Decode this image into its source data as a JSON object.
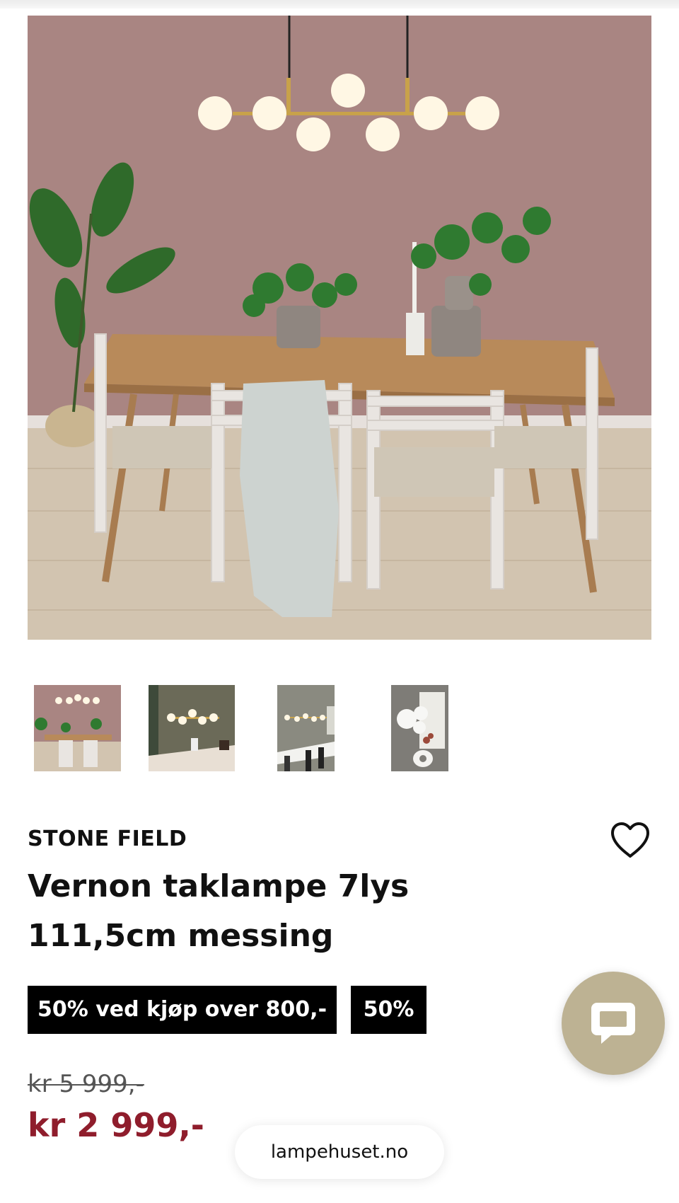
{
  "product": {
    "brand": "STONE FIELD",
    "title": "Vernon taklampe 7lys 111,5cm messing",
    "badges": [
      "50% ved kjøp over 800,-",
      "50%"
    ],
    "old_price": "kr 5 999,-",
    "price": "kr 2 999,-"
  },
  "gallery": {
    "main_image": "dining-room-photo",
    "thumbnails": [
      {
        "name": "thumbnail-1"
      },
      {
        "name": "thumbnail-2"
      },
      {
        "name": "thumbnail-3"
      },
      {
        "name": "thumbnail-4"
      }
    ]
  },
  "icons": {
    "wishlist": "heart-icon",
    "chat": "chat-bubble-icon"
  },
  "browser": {
    "url": "lampehuset.no"
  },
  "colors": {
    "price_red": "#8f1d2c",
    "badge_bg": "#000000",
    "chat_button": "#bdb293",
    "wall": "#a6807c"
  }
}
